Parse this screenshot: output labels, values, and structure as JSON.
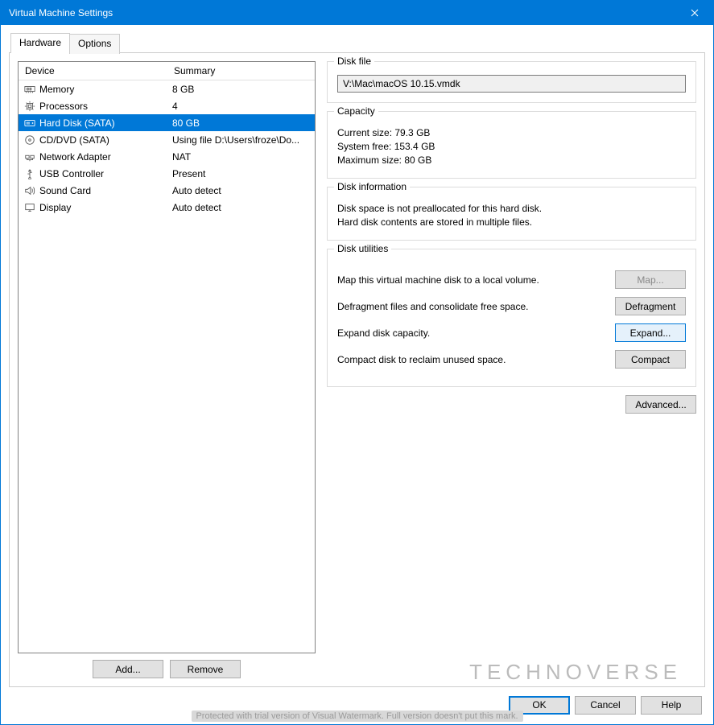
{
  "window": {
    "title": "Virtual Machine Settings"
  },
  "tabs": {
    "hardware": "Hardware",
    "options": "Options"
  },
  "columns": {
    "device": "Device",
    "summary": "Summary"
  },
  "devices": [
    {
      "name": "Memory",
      "summary": "8 GB",
      "icon": "memory"
    },
    {
      "name": "Processors",
      "summary": "4",
      "icon": "cpu"
    },
    {
      "name": "Hard Disk (SATA)",
      "summary": "80 GB",
      "icon": "hdd",
      "selected": true
    },
    {
      "name": "CD/DVD (SATA)",
      "summary": "Using file D:\\Users\\froze\\Do...",
      "icon": "cd"
    },
    {
      "name": "Network Adapter",
      "summary": "NAT",
      "icon": "net"
    },
    {
      "name": "USB Controller",
      "summary": "Present",
      "icon": "usb"
    },
    {
      "name": "Sound Card",
      "summary": "Auto detect",
      "icon": "sound"
    },
    {
      "name": "Display",
      "summary": "Auto detect",
      "icon": "display"
    }
  ],
  "left_buttons": {
    "add": "Add...",
    "remove": "Remove"
  },
  "disk_file": {
    "legend": "Disk file",
    "value": "V:\\Mac\\macOS 10.15.vmdk"
  },
  "capacity": {
    "legend": "Capacity",
    "current_label": "Current size:",
    "current_value": "79.3 GB",
    "free_label": "System free:",
    "free_value": "153.4 GB",
    "max_label": "Maximum size:",
    "max_value": "80 GB"
  },
  "disk_info": {
    "legend": "Disk information",
    "line1": "Disk space is not preallocated for this hard disk.",
    "line2": "Hard disk contents are stored in multiple files."
  },
  "utilities": {
    "legend": "Disk utilities",
    "map_label": "Map this virtual machine disk to a local volume.",
    "map_btn": "Map...",
    "defrag_label": "Defragment files and consolidate free space.",
    "defrag_btn": "Defragment",
    "expand_label": "Expand disk capacity.",
    "expand_btn": "Expand...",
    "compact_label": "Compact disk to reclaim unused space.",
    "compact_btn": "Compact"
  },
  "advanced_btn": "Advanced...",
  "dialog": {
    "ok": "OK",
    "cancel": "Cancel",
    "help": "Help"
  },
  "watermark": "Protected with trial version of Visual Watermark. Full version doesn't put this mark.",
  "brand": "TECHNOVERSE"
}
